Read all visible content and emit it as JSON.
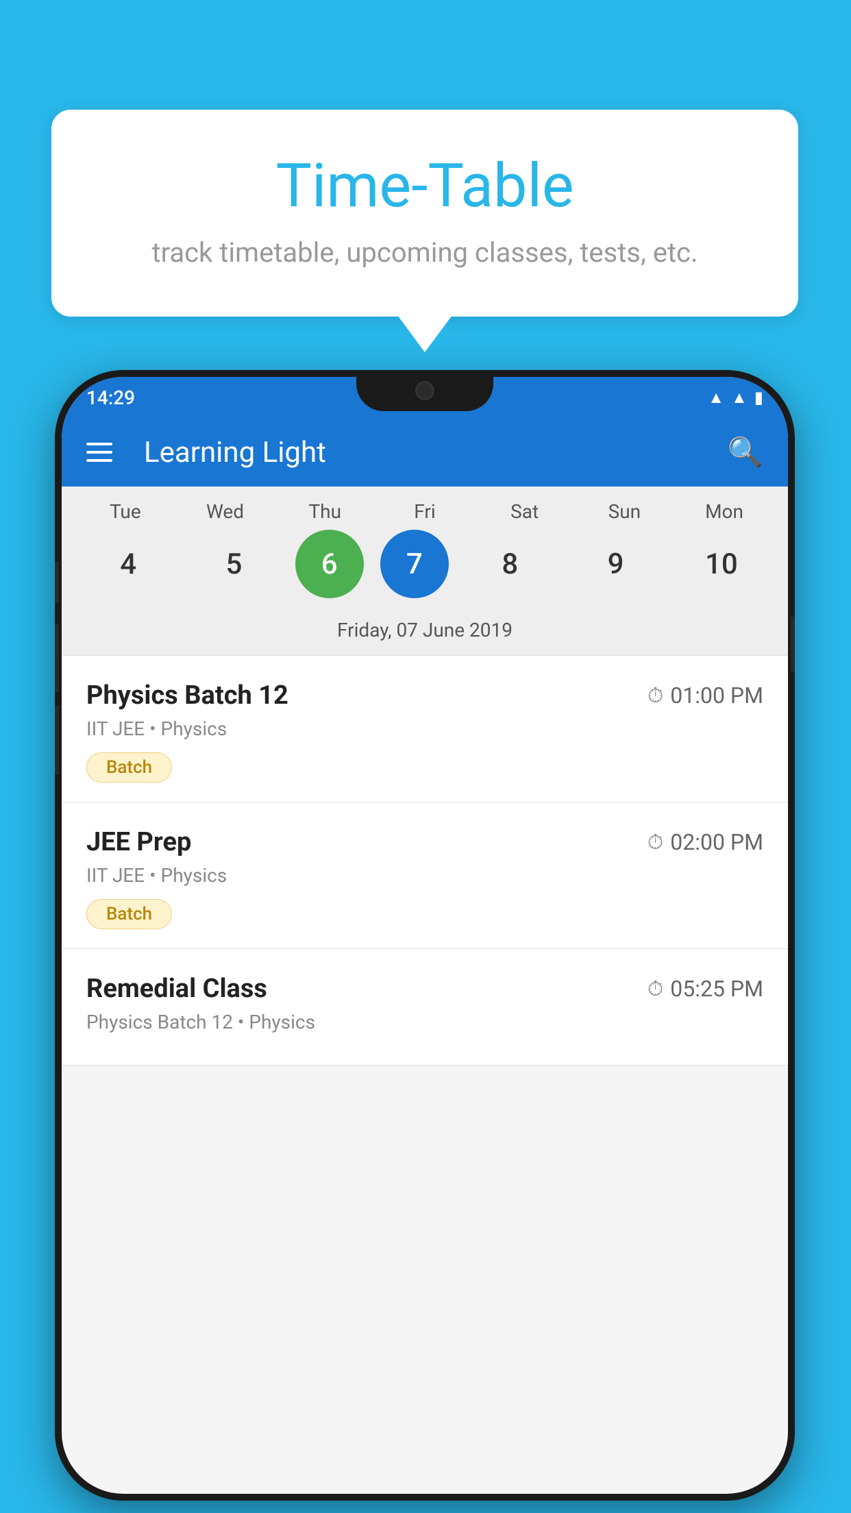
{
  "background_color": "#29b6e8",
  "tooltip": {
    "title": "Time-Table",
    "subtitle": "track timetable, upcoming classes, tests, etc."
  },
  "phone": {
    "status_bar": {
      "time": "14:29"
    },
    "app_bar": {
      "title": "Learning Light"
    },
    "calendar": {
      "days": [
        {
          "label": "Tue",
          "number": "4"
        },
        {
          "label": "Wed",
          "number": "5"
        },
        {
          "label": "Thu",
          "number": "6",
          "state": "today"
        },
        {
          "label": "Fri",
          "number": "7",
          "state": "selected"
        },
        {
          "label": "Sat",
          "number": "8"
        },
        {
          "label": "Sun",
          "number": "9"
        },
        {
          "label": "Mon",
          "number": "10"
        }
      ],
      "selected_date_label": "Friday, 07 June 2019"
    },
    "schedule": [
      {
        "title": "Physics Batch 12",
        "time": "01:00 PM",
        "subtitle": "IIT JEE • Physics",
        "badge": "Batch"
      },
      {
        "title": "JEE Prep",
        "time": "02:00 PM",
        "subtitle": "IIT JEE • Physics",
        "badge": "Batch"
      },
      {
        "title": "Remedial Class",
        "time": "05:25 PM",
        "subtitle": "Physics Batch 12 • Physics",
        "badge": null
      }
    ]
  }
}
